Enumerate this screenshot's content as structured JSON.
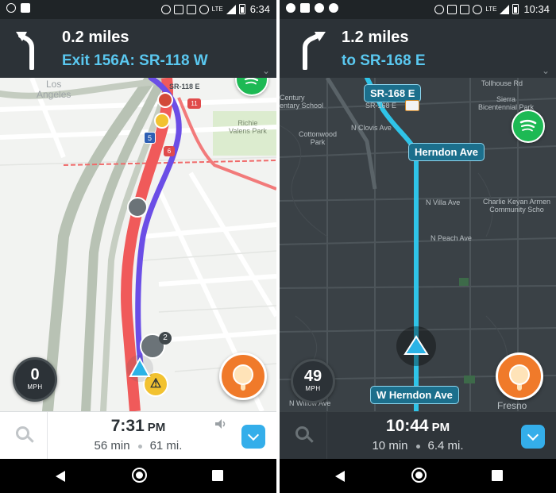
{
  "left": {
    "status": {
      "time": "6:34",
      "lte": "LTE"
    },
    "nav": {
      "distance": "0.2 miles",
      "street": "Exit 156A: SR-118 W"
    },
    "map": {
      "labels": {
        "los_angeles": "Los\nAngeles",
        "richie_park": "Richie\nValens Park",
        "sr118e": "SR-118 E"
      },
      "badges": {
        "route5": "5",
        "route11": "11",
        "route6": "6",
        "alert_count": "2"
      }
    },
    "speed": {
      "value": "0",
      "unit": "MPH"
    },
    "eta": {
      "time": "7:31",
      "ampm": "PM",
      "duration": "56 min",
      "distance": "61 mi."
    }
  },
  "right": {
    "status": {
      "time": "10:34",
      "lte": "LTE"
    },
    "nav": {
      "distance": "1.2 miles",
      "street": "to SR-168 E"
    },
    "map": {
      "labels": {
        "tollhouse": "Tollhouse Rd",
        "sierra": "Sierra\nBicentennial Park",
        "century": "Century\nentary School",
        "sr168e_small": "SR-168 E",
        "n_clovis": "N Clovis Ave",
        "cottonwood": "Cottonwood\nPark",
        "n_villa": "N Villa Ave",
        "charlie": "Charlie Keyan Armen\nCommunity Scho",
        "n_peach": "N Peach Ave",
        "n_willow": "N Willow Ave",
        "fresno": "Fresno"
      },
      "pills": {
        "sr168e": "SR-168 E",
        "herndon": "Herndon Ave",
        "w_herndon": "W Herndon Ave"
      }
    },
    "speed": {
      "value": "49",
      "unit": "MPH"
    },
    "eta": {
      "time": "10:44",
      "ampm": "PM",
      "duration": "10 min",
      "distance": "6.4 mi."
    }
  },
  "colors": {
    "banner_bg": "#2c3237",
    "street_blue": "#5ac8f0",
    "spotify_green": "#1db954",
    "route_purple": "#6b4ee6",
    "traffic_red": "#f05a5a",
    "route_cyan": "#2fc4e8",
    "report_orange": "#f07a2a",
    "expand_blue": "#34aeea"
  },
  "icons": [
    "turn-left-icon",
    "turn-right-icon",
    "spotify-icon",
    "search-icon",
    "chevron-down-icon",
    "report-icon",
    "navigation-arrow-icon",
    "police-icon",
    "hazard-icon",
    "sound-icon",
    "back-icon",
    "home-icon",
    "recents-icon"
  ]
}
